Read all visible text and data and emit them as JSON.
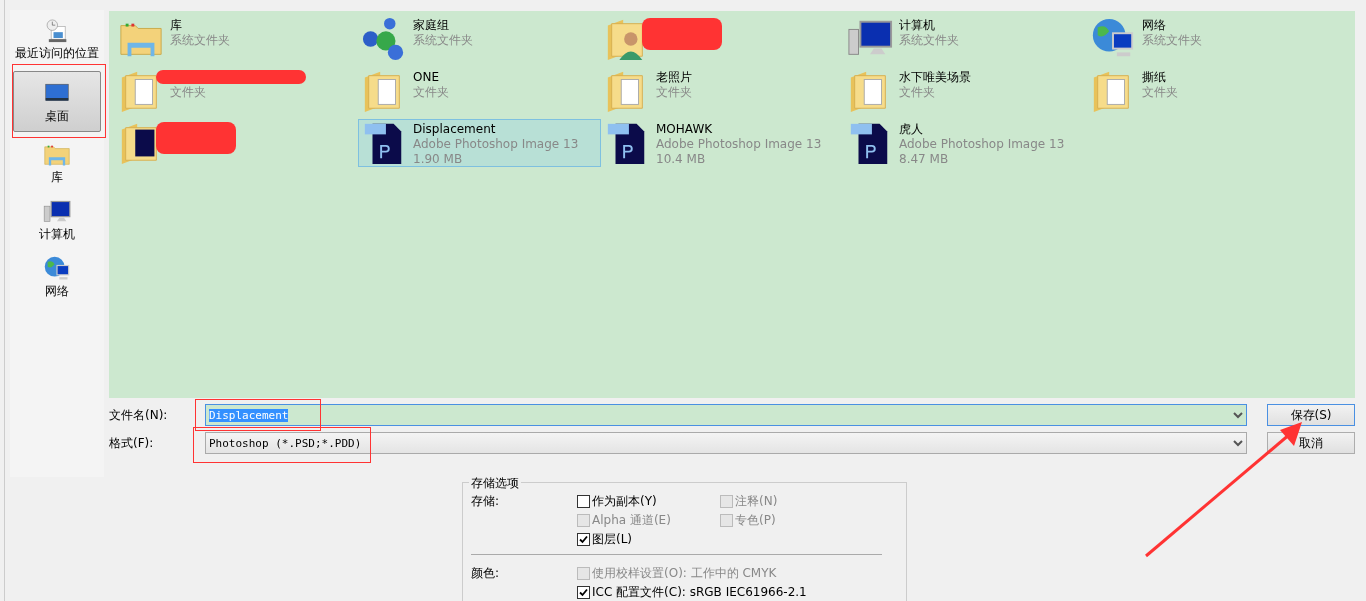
{
  "sidebar": {
    "items": [
      {
        "label": "最近访问的位置",
        "kind": "recent",
        "selected": false
      },
      {
        "label": "桌面",
        "kind": "desktop",
        "selected": true
      },
      {
        "label": "库",
        "kind": "library",
        "selected": false
      },
      {
        "label": "计算机",
        "kind": "computer",
        "selected": false
      },
      {
        "label": "网络",
        "kind": "network",
        "selected": false
      }
    ]
  },
  "files": [
    {
      "kind": "library",
      "name": "库",
      "detail": [
        "系统文件夹"
      ],
      "selected": false,
      "redacted": false
    },
    {
      "kind": "homegroup",
      "name": "家庭组",
      "detail": [
        "系统文件夹"
      ],
      "selected": false,
      "redacted": false
    },
    {
      "kind": "person-folder",
      "selected": false,
      "redacted": true
    },
    {
      "kind": "computer",
      "name": "计算机",
      "detail": [
        "系统文件夹"
      ],
      "selected": false,
      "redacted": false
    },
    {
      "kind": "network",
      "name": "网络",
      "detail": [
        "系统文件夹"
      ],
      "selected": false,
      "redacted": false
    },
    {
      "kind": "folder",
      "detail": [
        "文件夹"
      ],
      "selected": false,
      "redacted": true
    },
    {
      "kind": "folder",
      "name": "ONE",
      "detail": [
        "文件夹"
      ],
      "selected": false,
      "redacted": false
    },
    {
      "kind": "folder",
      "name": "老照片",
      "detail": [
        "文件夹"
      ],
      "selected": false,
      "redacted": false
    },
    {
      "kind": "folder",
      "name": "水下唯美场景",
      "detail": [
        "文件夹"
      ],
      "selected": false,
      "redacted": false
    },
    {
      "kind": "folder",
      "name": "撕纸",
      "detail": [
        "文件夹"
      ],
      "selected": false,
      "redacted": false
    },
    {
      "kind": "psd-folder",
      "selected": false,
      "redacted": true
    },
    {
      "kind": "psd",
      "name": "Displacement",
      "detail": [
        "Adobe Photoshop Image 13",
        "1.90 MB"
      ],
      "selected": true,
      "redacted": false
    },
    {
      "kind": "psd",
      "name": "MOHAWK",
      "detail": [
        "Adobe Photoshop Image 13",
        "10.4 MB"
      ],
      "selected": false,
      "redacted": false
    },
    {
      "kind": "psd",
      "name": "虎人",
      "detail": [
        "Adobe Photoshop Image 13",
        "8.47 MB"
      ],
      "selected": false,
      "redacted": false
    }
  ],
  "filename": {
    "label": "文件名(N):",
    "value": "Displacement"
  },
  "format": {
    "label": "格式(F):",
    "value": "Photoshop (*.PSD;*.PDD)"
  },
  "buttons": [
    {
      "label": "保存(S)",
      "focused": true
    },
    {
      "label": "取消",
      "focused": false
    }
  ],
  "save_options": {
    "title": "存储选项",
    "groups": [
      {
        "label": "存储:",
        "options": [
          {
            "label": "作为副本(Y)",
            "checked": false,
            "disabled": false
          },
          {
            "label": "注释(N)",
            "checked": false,
            "disabled": true
          },
          {
            "label": "Alpha 通道(E)",
            "checked": false,
            "disabled": true
          },
          {
            "label": "专色(P)",
            "checked": false,
            "disabled": true
          },
          {
            "label": "图层(L)",
            "checked": true,
            "disabled": false
          }
        ]
      },
      {
        "label": "颜色:",
        "options": [
          {
            "label": "使用校样设置(O):  工作中的 CMYK",
            "checked": false,
            "disabled": true
          },
          {
            "label": "ICC 配置文件(C):  sRGB IEC61966-2.1",
            "checked": true,
            "disabled": false
          }
        ]
      }
    ]
  }
}
